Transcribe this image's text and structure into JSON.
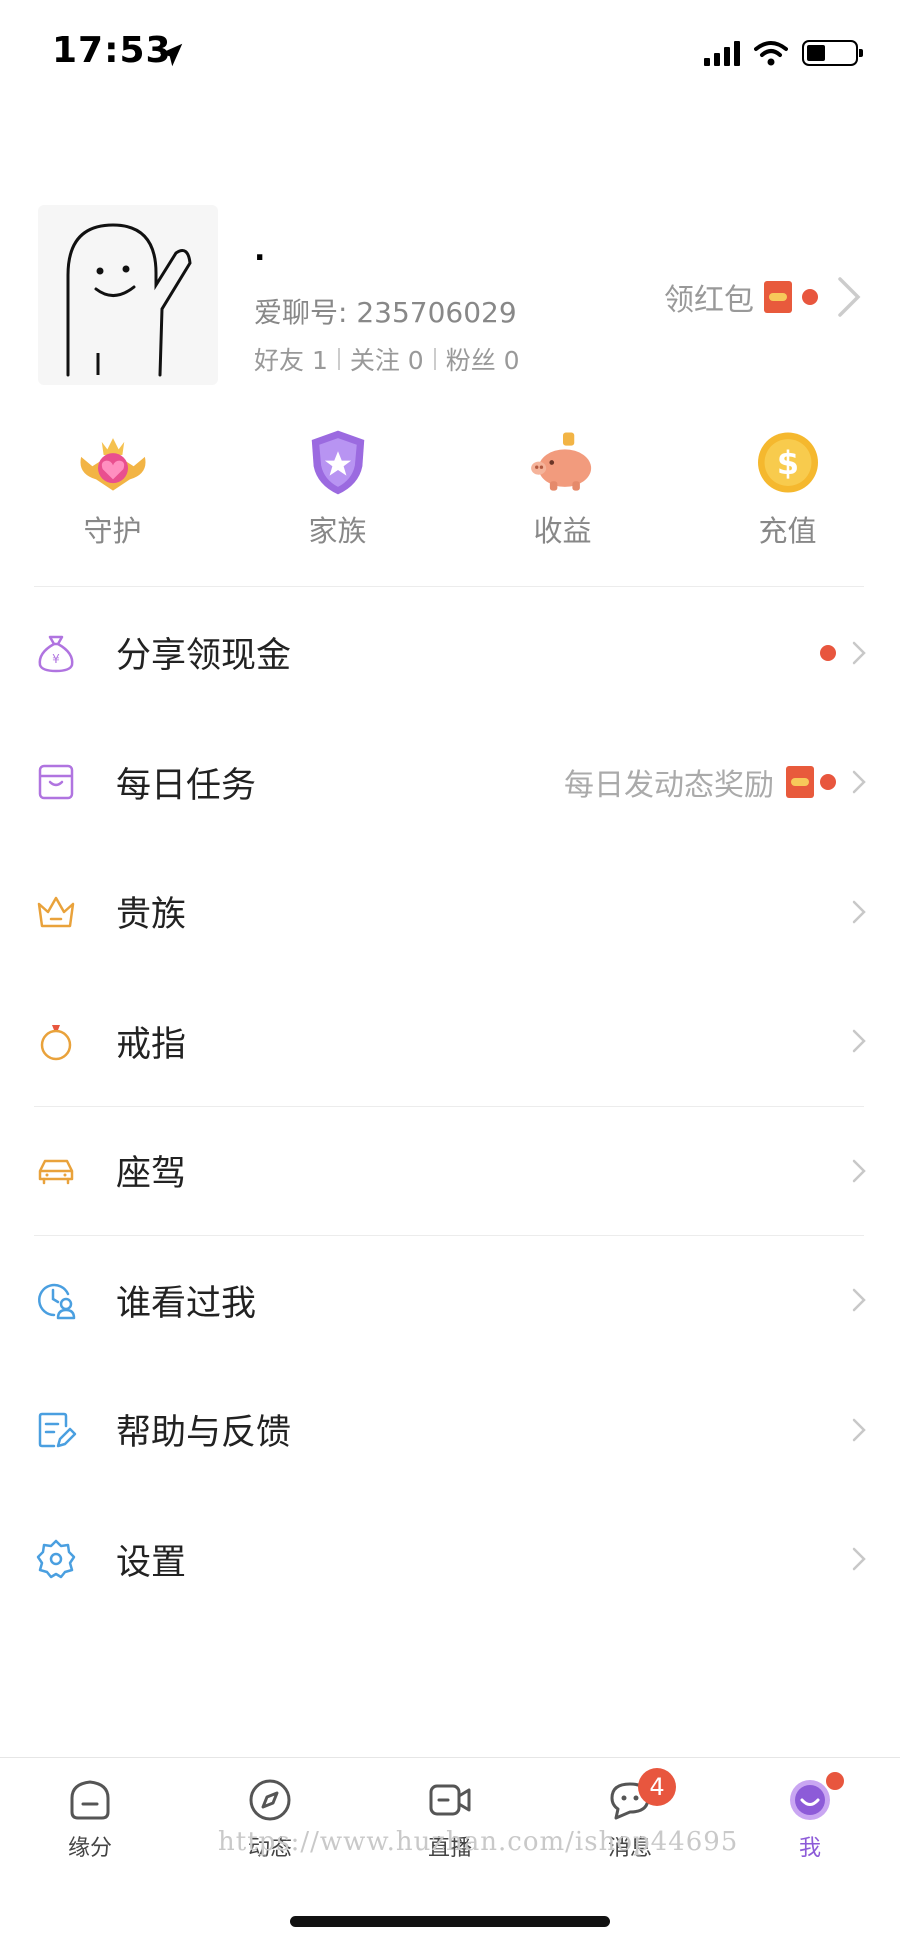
{
  "status_bar": {
    "time": "17:53"
  },
  "profile": {
    "nickname": ".",
    "uid": "爱聊号: 235706029",
    "stats": {
      "friends": "好友 1",
      "following": "关注 0",
      "fans": "粉丝 0"
    },
    "red_packet_label": "领红包"
  },
  "quick_actions": [
    {
      "label": "守护",
      "icon": "guard-crown-icon"
    },
    {
      "label": "家族",
      "icon": "family-shield-icon"
    },
    {
      "label": "收益",
      "icon": "piggy-bank-icon"
    },
    {
      "label": "充值",
      "icon": "coin-icon"
    }
  ],
  "menu": [
    {
      "label": "分享领现金",
      "icon": "money-bag-icon",
      "hint": ""
    },
    {
      "label": "每日任务",
      "icon": "task-icon",
      "hint": "每日发动态奖励"
    },
    {
      "label": "贵族",
      "icon": "crown-icon",
      "hint": ""
    },
    {
      "label": "戒指",
      "icon": "ring-icon",
      "hint": ""
    },
    {
      "label": "座驾",
      "icon": "car-icon",
      "hint": ""
    },
    {
      "label": "谁看过我",
      "icon": "visitor-icon",
      "hint": ""
    },
    {
      "label": "帮助与反馈",
      "icon": "feedback-icon",
      "hint": ""
    },
    {
      "label": "设置",
      "icon": "gear-icon",
      "hint": ""
    }
  ],
  "tabs": [
    {
      "label": "缘分",
      "icon": "home-icon"
    },
    {
      "label": "动态",
      "icon": "compass-icon"
    },
    {
      "label": "直播",
      "icon": "video-icon"
    },
    {
      "label": "消息",
      "icon": "chat-icon",
      "badge": "4"
    },
    {
      "label": "我",
      "icon": "me-icon",
      "active": true
    }
  ],
  "watermark": "https://www.huzhan.com/ishop44695",
  "colors": {
    "accent": "#8d5bd8",
    "red": "#e8563e",
    "gold": "#e9a23b",
    "blue": "#4a9fe0",
    "purple": "#b074e0"
  }
}
